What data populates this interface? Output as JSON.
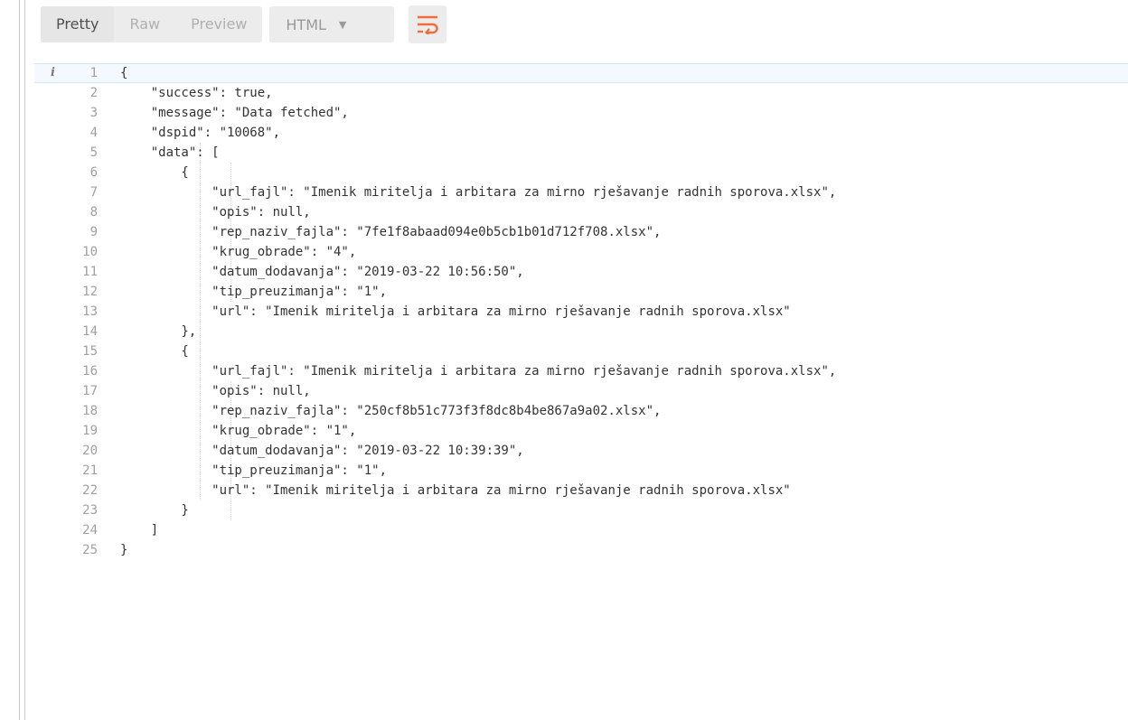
{
  "toolbar": {
    "tabs": [
      {
        "label": "Pretty",
        "active": true
      },
      {
        "label": "Raw",
        "active": false
      },
      {
        "label": "Preview",
        "active": false
      }
    ],
    "format_select": "HTML",
    "wrap_icon": "wrap-lines-icon",
    "wrap_color": "#f26b3a"
  },
  "editor": {
    "info_glyph": "i",
    "lines": [
      {
        "n": "1",
        "text": "{"
      },
      {
        "n": "2",
        "text": "    \"success\": true,"
      },
      {
        "n": "3",
        "text": "    \"message\": \"Data fetched\","
      },
      {
        "n": "4",
        "text": "    \"dspid\": \"10068\","
      },
      {
        "n": "5",
        "text": "    \"data\": ["
      },
      {
        "n": "6",
        "text": "        {"
      },
      {
        "n": "7",
        "text": "            \"url_fajl\": \"Imenik miritelja i arbitara za mirno rješavanje radnih sporova.xlsx\","
      },
      {
        "n": "8",
        "text": "            \"opis\": null,"
      },
      {
        "n": "9",
        "text": "            \"rep_naziv_fajla\": \"7fe1f8abaad094e0b5cb1b01d712f708.xlsx\","
      },
      {
        "n": "10",
        "text": "            \"krug_obrade\": \"4\","
      },
      {
        "n": "11",
        "text": "            \"datum_dodavanja\": \"2019-03-22 10:56:50\","
      },
      {
        "n": "12",
        "text": "            \"tip_preuzimanja\": \"1\","
      },
      {
        "n": "13",
        "text": "            \"url\": \"Imenik miritelja i arbitara za mirno rješavanje radnih sporova.xlsx\""
      },
      {
        "n": "14",
        "text": "        },"
      },
      {
        "n": "15",
        "text": "        {"
      },
      {
        "n": "16",
        "text": "            \"url_fajl\": \"Imenik miritelja i arbitara za mirno rješavanje radnih sporova.xlsx\","
      },
      {
        "n": "17",
        "text": "            \"opis\": null,"
      },
      {
        "n": "18",
        "text": "            \"rep_naziv_fajla\": \"250cf8b51c773f3f8dc8b4be867a9a02.xlsx\","
      },
      {
        "n": "19",
        "text": "            \"krug_obrade\": \"1\","
      },
      {
        "n": "20",
        "text": "            \"datum_dodavanja\": \"2019-03-22 10:39:39\","
      },
      {
        "n": "21",
        "text": "            \"tip_preuzimanja\": \"1\","
      },
      {
        "n": "22",
        "text": "            \"url\": \"Imenik miritelja i arbitara za mirno rješavanje radnih sporova.xlsx\""
      },
      {
        "n": "23",
        "text": "        }"
      },
      {
        "n": "24",
        "text": "    ]"
      },
      {
        "n": "25",
        "text": "}"
      }
    ]
  }
}
